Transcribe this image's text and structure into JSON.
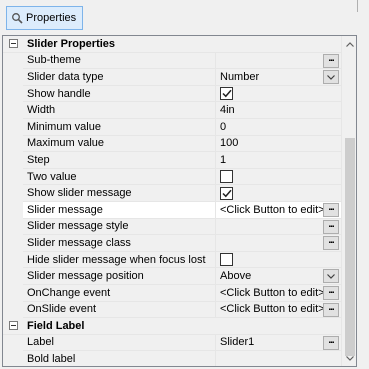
{
  "toolbar": {
    "properties_label": "Properties",
    "properties_icon": "properties-search-icon"
  },
  "sections": [
    {
      "title": "Slider Properties",
      "rows": [
        {
          "name": "Sub-theme",
          "value": "",
          "editor": "dots"
        },
        {
          "name": "Slider data type",
          "value": "Number",
          "editor": "dropdown"
        },
        {
          "name": "Show handle",
          "value": "",
          "editor": "checkbox",
          "checked": true
        },
        {
          "name": "Width",
          "value": "4in",
          "editor": "none"
        },
        {
          "name": "Minimum value",
          "value": "0",
          "editor": "none"
        },
        {
          "name": "Maximum value",
          "value": "100",
          "editor": "none"
        },
        {
          "name": "Step",
          "value": "1",
          "editor": "none"
        },
        {
          "name": "Two value",
          "value": "",
          "editor": "checkbox",
          "checked": false
        },
        {
          "name": "Show slider message",
          "value": "",
          "editor": "checkbox",
          "checked": true
        },
        {
          "name": "Slider message",
          "value": "<Click Button to edit>",
          "editor": "dots",
          "selected": true
        },
        {
          "name": "Slider message style",
          "value": "",
          "editor": "dots"
        },
        {
          "name": "Slider message class",
          "value": "",
          "editor": "dots"
        },
        {
          "name": "Hide slider message when focus lost",
          "value": "",
          "editor": "checkbox",
          "checked": false
        },
        {
          "name": "Slider message position",
          "value": "Above",
          "editor": "dropdown"
        },
        {
          "name": "OnChange event",
          "value": "<Click Button to edit>",
          "editor": "dots"
        },
        {
          "name": "OnSlide event",
          "value": "<Click Button to edit>",
          "editor": "dots"
        }
      ]
    },
    {
      "title": "Field Label",
      "rows": [
        {
          "name": "Label",
          "value": "Slider1",
          "editor": "dots"
        },
        {
          "name": "Bold label",
          "value": "",
          "editor": "none"
        }
      ]
    }
  ],
  "scrollbar": {
    "up_icon": "scroll-up-icon",
    "down_icon": "scroll-down-icon"
  }
}
